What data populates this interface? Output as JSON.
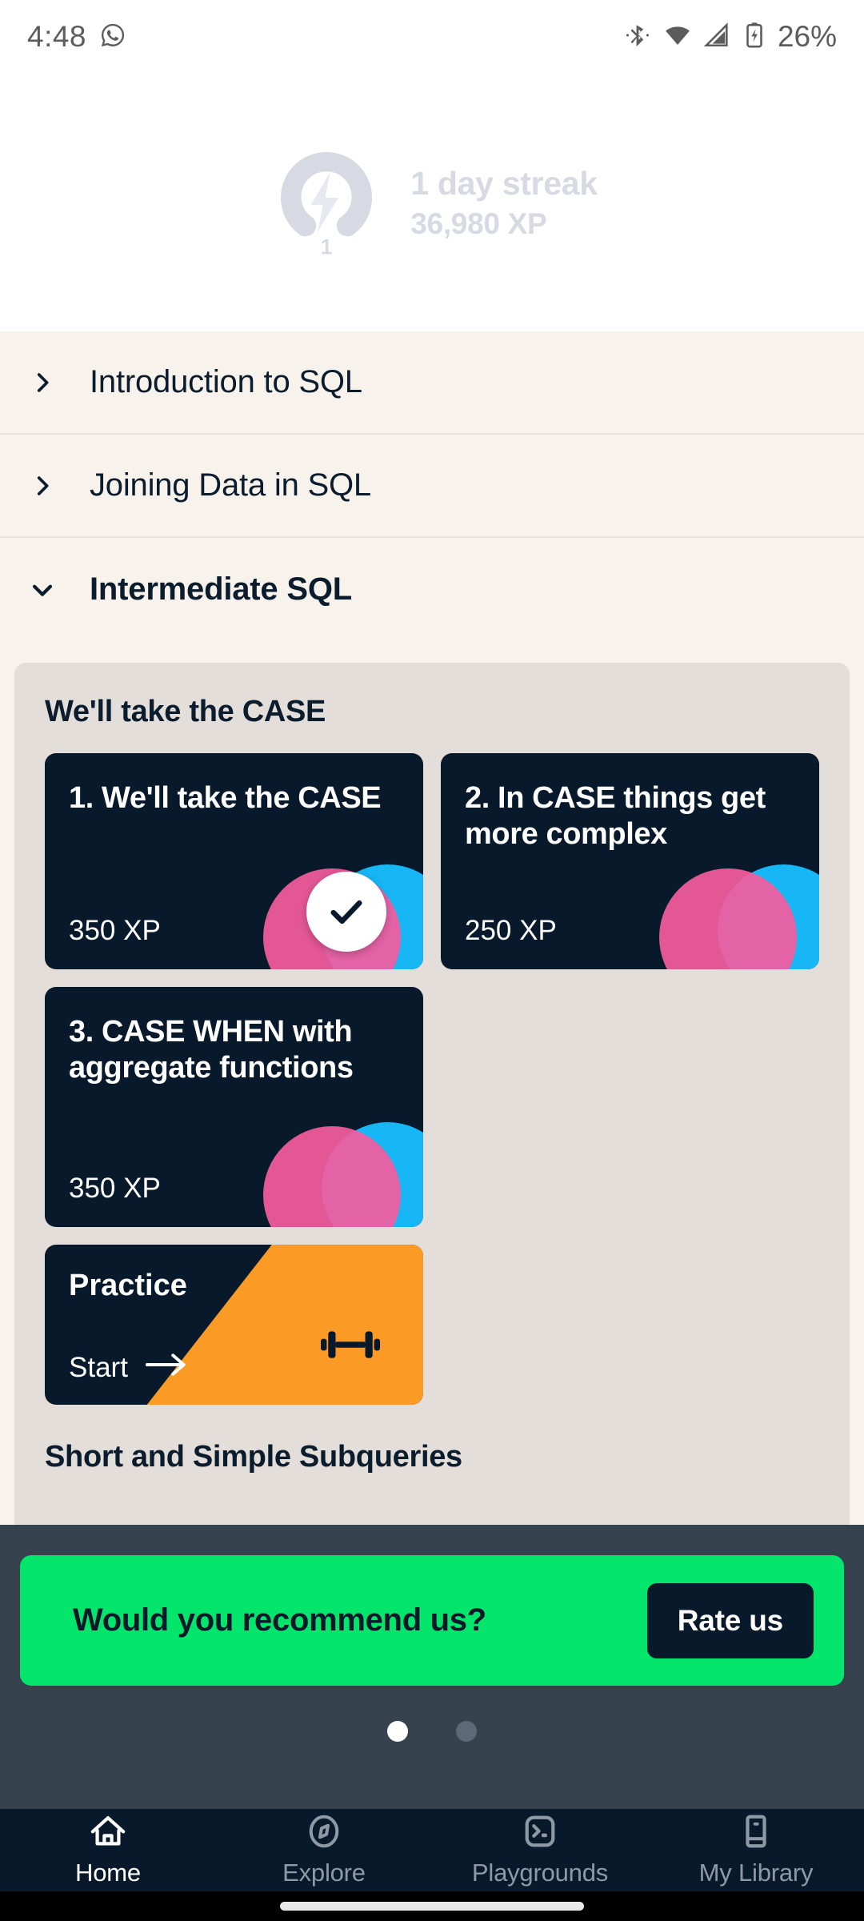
{
  "status_bar": {
    "time": "4:48",
    "battery_percent": "26%",
    "icons": [
      "whatsapp-icon",
      "bluetooth-icon",
      "wifi-icon",
      "cellular-signal-icon",
      "battery-charging-icon"
    ]
  },
  "streak": {
    "title": "1 day streak",
    "xp": "36,980 XP",
    "ring_value": "1"
  },
  "courses": [
    {
      "label": "Introduction to SQL",
      "expanded": false,
      "chevron": "chevron-right-icon"
    },
    {
      "label": "Joining Data in SQL",
      "expanded": false,
      "chevron": "chevron-right-icon"
    },
    {
      "label": "Intermediate SQL",
      "expanded": true,
      "chevron": "chevron-down-icon"
    }
  ],
  "chapter": {
    "heading": "We'll take the CASE",
    "next_heading": "Short and Simple Subqueries",
    "lessons": [
      {
        "title": "1. We'll take the CASE",
        "xp": "350 XP",
        "completed": true
      },
      {
        "title": "2. In CASE things get more complex",
        "xp": "250 XP",
        "completed": false
      },
      {
        "title": "3. CASE WHEN with aggregate functions",
        "xp": "350 XP",
        "completed": false
      }
    ],
    "practice": {
      "title": "Practice",
      "action": "Start",
      "arrow": "arrow-right-icon",
      "icon": "dumbbell-icon"
    }
  },
  "promo": {
    "question": "Would you recommend us?",
    "button_label": "Rate us",
    "pagination": {
      "total": 2,
      "active_index": 0
    }
  },
  "bottom_nav": [
    {
      "label": "Home",
      "icon": "home-icon",
      "active": true
    },
    {
      "label": "Explore",
      "icon": "compass-icon",
      "active": false
    },
    {
      "label": "Playgrounds",
      "icon": "terminal-icon",
      "active": false
    },
    {
      "label": "My Library",
      "icon": "book-icon",
      "active": false
    }
  ],
  "colors": {
    "card_dark": "#09192C",
    "panel_bg": "#E3DEDA",
    "list_bg": "#F7F2EC",
    "accent_green": "#03E56B",
    "accent_orange": "#FB9B25",
    "accent_pink": "#F65C9E",
    "accent_cyan": "#17B6F5",
    "overlay": "#36434F"
  }
}
